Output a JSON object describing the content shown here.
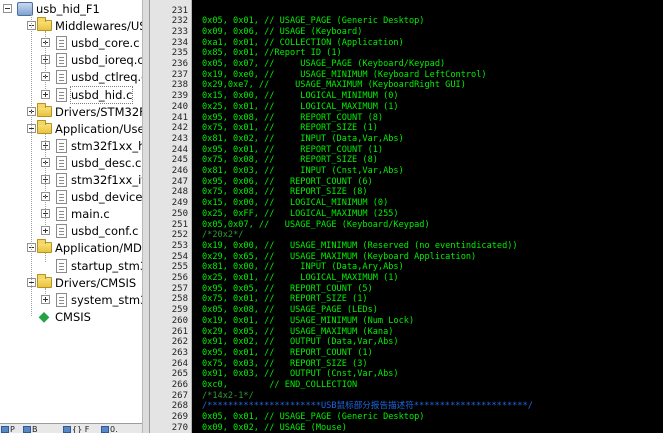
{
  "colors": {
    "editor_bg": "#000000",
    "code_text": "#00f000",
    "comment_text": "#2f9a34",
    "highlight_comment": "#1f66e0",
    "gutter_bg": "#e4e4e4",
    "tree_bg": "#ffffff"
  },
  "tree": {
    "items": [
      {
        "label": "usb_hid_F1",
        "icon": "project-root-icon",
        "expander": "minus",
        "level": 0
      },
      {
        "label": "Middlewares/USB_l",
        "icon": "folder-icon",
        "expander": "minus",
        "level": 1
      },
      {
        "label": "usbd_core.c",
        "icon": "file-icon",
        "expander": "plus",
        "level": 2
      },
      {
        "label": "usbd_ioreq.c",
        "icon": "file-icon",
        "expander": "plus",
        "level": 2
      },
      {
        "label": "usbd_ctlreq.c",
        "icon": "file-icon",
        "expander": "plus",
        "level": 2
      },
      {
        "label": "usbd_hid.c",
        "icon": "file-icon",
        "expander": "plus",
        "level": 2,
        "selected": true
      },
      {
        "label": "Drivers/STM32F1xx",
        "icon": "folder-icon",
        "expander": "plus",
        "level": 1
      },
      {
        "label": "Application/User",
        "icon": "folder-icon",
        "expander": "minus",
        "level": 1
      },
      {
        "label": "stm32f1xx_hal_r",
        "icon": "file-icon",
        "expander": "plus",
        "level": 2
      },
      {
        "label": "usbd_desc.c",
        "icon": "file-icon",
        "expander": "plus",
        "level": 2
      },
      {
        "label": "stm32f1xx_it.c",
        "icon": "file-icon",
        "expander": "plus",
        "level": 2
      },
      {
        "label": "usbd_device.c",
        "icon": "file-icon",
        "expander": "plus",
        "level": 2
      },
      {
        "label": "main.c",
        "icon": "file-icon",
        "expander": "plus",
        "level": 2
      },
      {
        "label": "usbd_conf.c",
        "icon": "file-icon",
        "expander": "plus",
        "level": 2
      },
      {
        "label": "Application/MDK-A",
        "icon": "folder-icon",
        "expander": "minus",
        "level": 1
      },
      {
        "label": "startup_stm32f1",
        "icon": "file-icon",
        "expander": "none",
        "level": 2
      },
      {
        "label": "Drivers/CMSIS",
        "icon": "folder-icon",
        "expander": "minus",
        "level": 1
      },
      {
        "label": "system_stm32f1",
        "icon": "file-icon",
        "expander": "plus",
        "level": 2
      },
      {
        "label": "CMSIS",
        "icon": "cmsis-diamond-icon",
        "expander": "none",
        "level": 1
      }
    ]
  },
  "bottom_tabs": [
    {
      "label": "P",
      "icon": "project-tab-icon"
    },
    {
      "label": "B",
      "icon": "books-tab-icon"
    },
    {
      "label": "{} F",
      "icon": "functions-tab-icon"
    },
    {
      "label": "0.",
      "icon": "templates-tab-icon"
    }
  ],
  "editor": {
    "lines": [
      {
        "num": "231",
        "text": "",
        "style": "code"
      },
      {
        "num": "232",
        "text": "0x05, 0x01, // USAGE_PAGE (Generic Desktop)",
        "style": "code"
      },
      {
        "num": "233",
        "text": "0x09, 0x06, // USAGE (Keyboard)",
        "style": "code"
      },
      {
        "num": "234",
        "text": "0xa1, 0x01, // COLLECTION (Application)",
        "style": "code"
      },
      {
        "num": "235",
        "text": "0x85, 0x01, //Report ID (1)",
        "style": "code"
      },
      {
        "num": "236",
        "text": "0x05, 0x07, //     USAGE_PAGE (Keyboard/Keypad)",
        "style": "code"
      },
      {
        "num": "237",
        "text": "0x19, 0xe0, //     USAGE_MINIMUM (Keyboard LeftControl)",
        "style": "code"
      },
      {
        "num": "238",
        "text": "0x29,0xe7, //     USAGE_MAXIMUM (KeyboardRight GUI)",
        "style": "code"
      },
      {
        "num": "239",
        "text": "0x15, 0x00, //     LOGICAL_MINIMUM (0)",
        "style": "code"
      },
      {
        "num": "240",
        "text": "0x25, 0x01, //     LOGICAL_MAXIMUM (1)",
        "style": "code"
      },
      {
        "num": "241",
        "text": "0x95, 0x08, //     REPORT_COUNT (8)",
        "style": "code"
      },
      {
        "num": "242",
        "text": "0x75, 0x01, //     REPORT_SIZE (1)",
        "style": "code"
      },
      {
        "num": "243",
        "text": "0x81, 0x02, //     INPUT (Data,Var,Abs)",
        "style": "code"
      },
      {
        "num": "244",
        "text": "0x95, 0x01, //     REPORT_COUNT (1)",
        "style": "code"
      },
      {
        "num": "245",
        "text": "0x75, 0x08, //     REPORT_SIZE (8)",
        "style": "code"
      },
      {
        "num": "246",
        "text": "0x81, 0x03, //     INPUT (Cnst,Var,Abs)",
        "style": "code"
      },
      {
        "num": "247",
        "text": "0x95, 0x06, //   REPORT_COUNT (6)",
        "style": "code"
      },
      {
        "num": "248",
        "text": "0x75, 0x08, //   REPORT_SIZE (8)",
        "style": "code"
      },
      {
        "num": "249",
        "text": "0x15, 0x00, //   LOGICAL_MINIMUM (0)",
        "style": "code"
      },
      {
        "num": "250",
        "text": "0x25, 0xFF, //   LOGICAL_MAXIMUM (255)",
        "style": "code"
      },
      {
        "num": "251",
        "text": "0x05,0x07, //   USAGE_PAGE (Keyboard/Keypad)",
        "style": "code"
      },
      {
        "num": "252",
        "text": "/*20x2*/",
        "style": "comment"
      },
      {
        "num": "253",
        "text": "0x19, 0x00, //   USAGE_MINIMUM (Reserved (no eventindicated))",
        "style": "code"
      },
      {
        "num": "254",
        "text": "0x29, 0x65, //   USAGE_MAXIMUM (Keyboard Application)",
        "style": "code"
      },
      {
        "num": "255",
        "text": "0x81, 0x00, //     INPUT (Data,Ary,Abs)",
        "style": "code"
      },
      {
        "num": "256",
        "text": "0x25, 0x01, //     LOGICAL_MAXIMUM (1)",
        "style": "code"
      },
      {
        "num": "257",
        "text": "0x95, 0x05, //   REPORT_COUNT (5)",
        "style": "code"
      },
      {
        "num": "258",
        "text": "0x75, 0x01, //   REPORT_SIZE (1)",
        "style": "code"
      },
      {
        "num": "259",
        "text": "0x05, 0x08, //   USAGE_PAGE (LEDs)",
        "style": "code"
      },
      {
        "num": "260",
        "text": "0x19, 0x01, //   USAGE_MINIMUM (Num Lock)",
        "style": "code"
      },
      {
        "num": "261",
        "text": "0x29, 0x05, //   USAGE_MAXIMUM (Kana)",
        "style": "code"
      },
      {
        "num": "262",
        "text": "0x91, 0x02, //   OUTPUT (Data,Var,Abs)",
        "style": "code"
      },
      {
        "num": "263",
        "text": "0x95, 0x01, //   REPORT_COUNT (1)",
        "style": "code"
      },
      {
        "num": "264",
        "text": "0x75, 0x03, //   REPORT_SIZE (3)",
        "style": "code"
      },
      {
        "num": "265",
        "text": "0x91, 0x03, //   OUTPUT (Cnst,Var,Abs)",
        "style": "code"
      },
      {
        "num": "266",
        "text": "0xc0,        // END_COLLECTION",
        "style": "code"
      },
      {
        "num": "267",
        "text": "/*14x2-1*/",
        "style": "comment"
      },
      {
        "num": "268",
        "text": "/**********************USB鼠标部分报告描述符**********************/",
        "style": "comment"
      },
      {
        "num": "269",
        "text": "0x05, 0x01, // USAGE_PAGE (Generic Desktop)",
        "style": "code"
      },
      {
        "num": "270",
        "text": "0x09, 0x02, // USAGE (Mouse)",
        "style": "code"
      }
    ]
  }
}
